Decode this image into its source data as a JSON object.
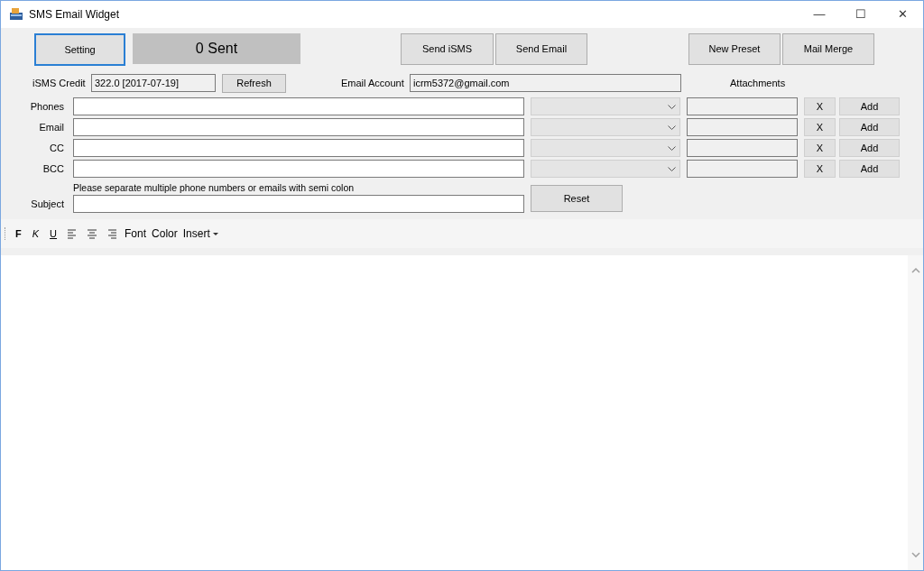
{
  "window": {
    "title": "SMS Email Widget",
    "controls": [
      "—",
      "☐",
      "✕"
    ]
  },
  "top_buttons": {
    "setting": "Setting",
    "sent_count": "0 Sent",
    "send_isms": "Send iSMS",
    "send_email": "Send Email",
    "new_preset": "New Preset",
    "mail_merge": "Mail Merge"
  },
  "credit": {
    "label": "iSMS Credit",
    "value": "322.0 [2017-07-19]",
    "refresh": "Refresh"
  },
  "email_account": {
    "label": "Email Account",
    "value": "icrm5372@gmail.com"
  },
  "attachments_label": "Attachments",
  "recipient_rows": [
    {
      "label": "Phones",
      "remove": "X",
      "add": "Add"
    },
    {
      "label": "Email",
      "remove": "X",
      "add": "Add"
    },
    {
      "label": "CC",
      "remove": "X",
      "add": "Add"
    },
    {
      "label": "BCC",
      "remove": "X",
      "add": "Add"
    }
  ],
  "hint": "Please separate multiple phone numbers or emails with semi colon",
  "subject": {
    "label": "Subject"
  },
  "reset": "Reset",
  "toolbar": [
    {
      "kind": "bold",
      "text": "F"
    },
    {
      "kind": "italic",
      "text": "K"
    },
    {
      "kind": "underline",
      "text": "U"
    },
    {
      "kind": "align-left"
    },
    {
      "kind": "align-center"
    },
    {
      "kind": "align-right"
    },
    {
      "kind": "text",
      "text": "Font"
    },
    {
      "kind": "text",
      "text": "Color"
    },
    {
      "kind": "dropdown",
      "text": "Insert"
    }
  ]
}
